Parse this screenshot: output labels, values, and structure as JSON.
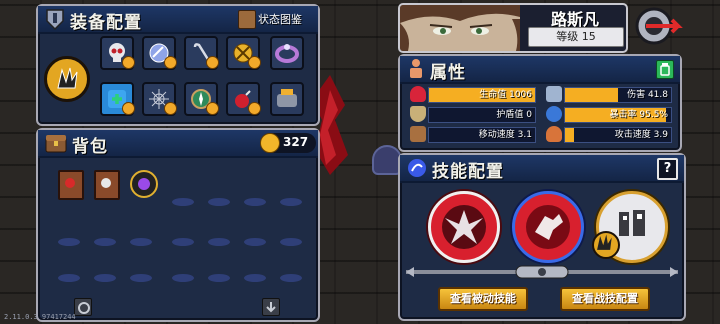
{
  "equipment_panel": {
    "title": "装备配置",
    "status_button": "状态图鉴"
  },
  "hero": {
    "name": "路斯凡",
    "level_text": "等级 15"
  },
  "attributes_panel": {
    "title": "属性",
    "stats_left": [
      {
        "label": "生命值",
        "value": "1006",
        "fill": 1.0,
        "color": "#d8243a"
      },
      {
        "label": "护盾值",
        "value": "0",
        "fill": 0.0,
        "color": "#c8b078"
      },
      {
        "label": "移动速度",
        "value": "3.1",
        "fill": 0.0,
        "color": "#a87040"
      }
    ],
    "stats_right": [
      {
        "label": "伤害",
        "value": "41.8",
        "fill": 0.5,
        "color": "#a0b4d0"
      },
      {
        "label": "暴击率",
        "value": "95.5%",
        "fill": 0.95,
        "color": "#3a78d8"
      },
      {
        "label": "攻击速度",
        "value": "3.9",
        "fill": 0.08,
        "color": "#d8743a"
      }
    ]
  },
  "backpack_panel": {
    "title": "背包",
    "coins": "327"
  },
  "skills_panel": {
    "title": "技能配置",
    "help_icon_text": "?",
    "passive_button": "查看被动技能",
    "battle_button": "查看战技配置"
  },
  "version_text": "2.11.0.3 97417244",
  "colors": {
    "panel_bg": "#1e2b45",
    "header_bg": "#1e3766",
    "accent_gold": "#f5ae22",
    "health_red": "#d8243a",
    "crit_blue": "#3a78d8"
  }
}
